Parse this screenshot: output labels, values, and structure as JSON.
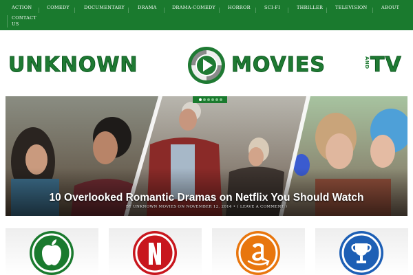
{
  "nav": {
    "items": [
      "Action",
      "Comedy",
      "Documentary",
      "Drama",
      "Drama-Comedy",
      "Horror",
      "Sci-Fi",
      "Thriller",
      "Television",
      "About"
    ],
    "contact": "Contact Us"
  },
  "logo": {
    "left_word": "UNKNOWN",
    "right_word": "MOVIES",
    "and_word": "AND",
    "tv_word": "TV",
    "colors": {
      "green": "#1f7a33",
      "grey": "#8a8a8a"
    }
  },
  "slider": {
    "dots_count": 6,
    "active_dot": 1,
    "title": "10 Overlooked Romantic Dramas on Netflix You Should Watch",
    "meta": "By Unknown Movies on November 12, 2014 • ( Leave a comment )"
  },
  "cards": [
    {
      "name": "apple-icon",
      "color": "#1a7a2e"
    },
    {
      "name": "netflix-icon",
      "color": "#c8161d"
    },
    {
      "name": "amazon-icon",
      "color": "#e8760e"
    },
    {
      "name": "trophy-icon",
      "color": "#1d5fb5"
    }
  ],
  "colors": {
    "nav_bg": "#1a7a2e"
  }
}
